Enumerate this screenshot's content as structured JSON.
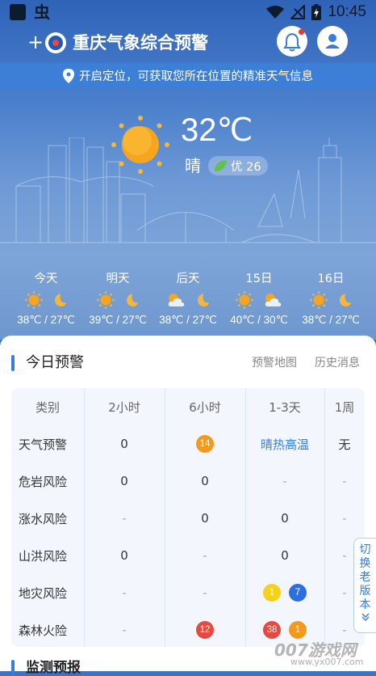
{
  "status_bar": {
    "time": "10:45",
    "left_glyph": "虫"
  },
  "titlebar": {
    "add_symbol": "+",
    "title": "重庆气象综合预警"
  },
  "location_banner": {
    "text": "开启定位，可获取您所在位置的精准天气信息"
  },
  "current": {
    "temperature": "32℃",
    "condition": "晴",
    "aqi": "优 26"
  },
  "forecast": [
    {
      "label": "今天",
      "icons": [
        "sun-icon",
        "moon-icon"
      ],
      "temp": "38℃ / 27℃"
    },
    {
      "label": "明天",
      "icons": [
        "sun-icon",
        "moon-icon"
      ],
      "temp": "39℃ / 27℃"
    },
    {
      "label": "后天",
      "icons": [
        "partly-cloudy-icon",
        "moon-icon"
      ],
      "temp": "38℃ / 27℃"
    },
    {
      "label": "15日",
      "icons": [
        "sun-icon",
        "partly-cloudy-icon"
      ],
      "temp": "40℃ / 30℃"
    },
    {
      "label": "16日",
      "icons": [
        "sun-icon",
        "moon-icon"
      ],
      "temp": "38℃ / 27℃"
    }
  ],
  "warning_card": {
    "title": "今日预警",
    "links": [
      "预警地图",
      "历史消息"
    ],
    "columns": [
      "类别",
      "2小时",
      "6小时",
      "1-3天",
      "1周"
    ],
    "rows": [
      {
        "category": "天气预警",
        "h2": "0",
        "h6": "14",
        "d13": "晴热高温",
        "w1": "无"
      },
      {
        "category": "危岩风险",
        "h2": "0",
        "h6": "0",
        "d13": "-",
        "w1": "-"
      },
      {
        "category": "涨水风险",
        "h2": "-",
        "h6": "0",
        "d13": "0",
        "w1": "-"
      },
      {
        "category": "山洪风险",
        "h2": "0",
        "h6": "-",
        "d13": "0",
        "w1": "-"
      },
      {
        "category": "地灾风险",
        "h2": "-",
        "h6": "-",
        "d13_badges": [
          "1",
          "7"
        ],
        "w1": "-"
      },
      {
        "category": "森林火险",
        "h2": "-",
        "h6": "12",
        "d13_badges": [
          "38",
          "1"
        ],
        "w1": "-"
      }
    ],
    "badge_colors": {
      "orange": "#f39a1e",
      "yellow": "#f4d21c",
      "blue": "#2c6fe0",
      "red": "#e8483d"
    }
  },
  "side_tab": {
    "label": "切换老版本"
  },
  "next_section": {
    "title": "监测预报"
  },
  "watermark": {
    "brand": "007游戏网",
    "url": "www.yx007.com"
  },
  "colors": {
    "accent": "#3a7cdc",
    "hero_top": "#2f63b8",
    "banner": "#3d7ed6"
  }
}
